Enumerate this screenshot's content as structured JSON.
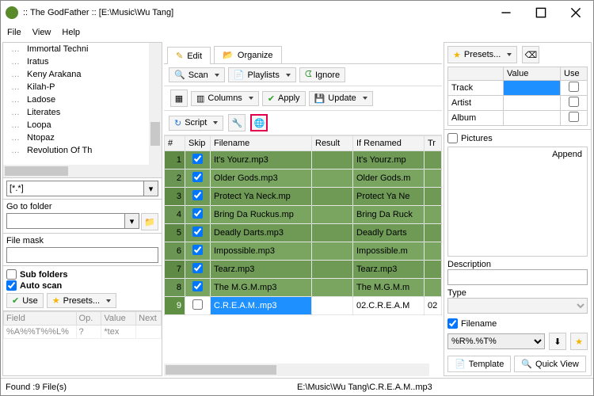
{
  "window": {
    "title": ":: The GodFather ::   [E:\\Music\\Wu Tang]"
  },
  "menubar": {
    "file": "File",
    "view": "View",
    "help": "Help"
  },
  "left": {
    "tree_nodes": [
      "Immortal Techni",
      "Iratus",
      "Keny Arakana",
      "Kilah-P",
      "Ladose",
      "Literates",
      "Loopa",
      "Ntopaz",
      "Revolution Of Th"
    ],
    "filter_value": "[*.*]",
    "goto_label": "Go to folder",
    "goto_value": "",
    "filemask_label": "File mask",
    "filemask_value": "",
    "subfolders": {
      "label": "Sub folders",
      "checked": false
    },
    "autoscan": {
      "label": "Auto scan",
      "checked": true
    },
    "use_btn": "Use",
    "presets_btn": "Presets...",
    "table": {
      "headers": [
        "Field",
        "Op.",
        "Value",
        "Next"
      ],
      "row": [
        "%A%%T%%L%",
        "?",
        "*tex",
        ""
      ]
    }
  },
  "tabs": {
    "edit": "Edit",
    "organize": "Organize"
  },
  "toolbar": {
    "scan": "Scan",
    "playlists": "Playlists",
    "ignore": "Ignore",
    "columns": "Columns",
    "apply": "Apply",
    "update": "Update",
    "script": "Script"
  },
  "grid": {
    "headers": [
      "#",
      "Skip",
      "Filename",
      "Result",
      "If Renamed",
      "Tr"
    ],
    "rows": [
      {
        "n": 1,
        "skip": true,
        "filename": "It's Yourz.mp3",
        "result": "",
        "ifren": "It's Yourz.mp"
      },
      {
        "n": 2,
        "skip": true,
        "filename": "Older Gods.mp3",
        "result": "",
        "ifren": "Older Gods.m"
      },
      {
        "n": 3,
        "skip": true,
        "filename": "Protect Ya Neck.mp",
        "result": "",
        "ifren": "Protect Ya Ne"
      },
      {
        "n": 4,
        "skip": true,
        "filename": "Bring Da Ruckus.mp",
        "result": "",
        "ifren": "Bring Da Ruck"
      },
      {
        "n": 5,
        "skip": true,
        "filename": "Deadly Darts.mp3",
        "result": "",
        "ifren": "Deadly Darts"
      },
      {
        "n": 6,
        "skip": true,
        "filename": "Impossible.mp3",
        "result": "",
        "ifren": "Impossible.m"
      },
      {
        "n": 7,
        "skip": true,
        "filename": "Tearz.mp3",
        "result": "",
        "ifren": "Tearz.mp3"
      },
      {
        "n": 8,
        "skip": true,
        "filename": "The M.G.M.mp3",
        "result": "",
        "ifren": "The M.G.M.m"
      },
      {
        "n": 9,
        "skip": false,
        "filename": "C.R.E.A.M..mp3",
        "result": "",
        "ifren": "02.C.R.E.A.M",
        "tr": "02",
        "selected": true
      }
    ]
  },
  "right": {
    "presets_btn": "Presets...",
    "table": {
      "headers": [
        "",
        "Value",
        "Use"
      ],
      "rows": [
        {
          "label": "Track",
          "highlight": true
        },
        {
          "label": "Artist"
        },
        {
          "label": "Album"
        }
      ]
    },
    "pictures_label": "Pictures",
    "append_label": "Append",
    "description_label": "Description",
    "type_label": "Type",
    "filename_check": "Filename",
    "filename_pattern": "%R%.%T%",
    "tab_template": "Template",
    "tab_quickview": "Quick View"
  },
  "status": {
    "left": "Found :9 File(s)",
    "right": "E:\\Music\\Wu Tang\\C.R.E.A.M..mp3"
  }
}
